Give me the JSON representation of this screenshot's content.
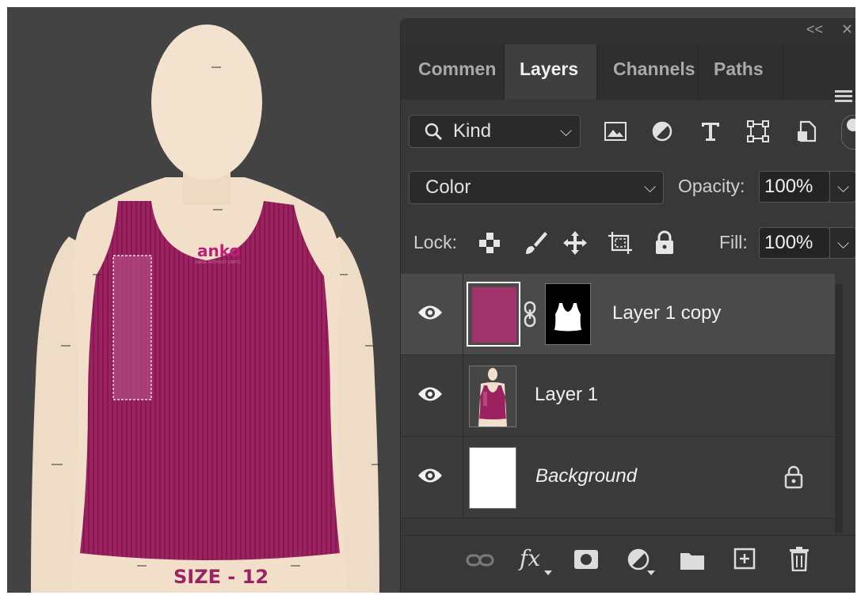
{
  "canvas": {
    "brand_logo": "anko",
    "brand_tagline": "MADE WITHOUT LIMITS",
    "size_label": "SIZE - 12",
    "garment_color": "#9c2160"
  },
  "panel": {
    "collapse_label": "<<",
    "close_label": "✕",
    "tabs": [
      {
        "label": "Commen"
      },
      {
        "label": "Layers"
      },
      {
        "label": "Channels"
      },
      {
        "label": "Paths"
      }
    ],
    "filter": {
      "label": "Kind"
    },
    "blend_mode": {
      "value": "Color"
    },
    "opacity": {
      "label": "Opacity:",
      "value": "100%"
    },
    "lock": {
      "label": "Lock:"
    },
    "fill": {
      "label": "Fill:",
      "value": "100%"
    },
    "layers": [
      {
        "name": "Layer 1 copy",
        "selected": true,
        "color": "#a0346a"
      },
      {
        "name": "Layer 1",
        "selected": false
      },
      {
        "name": "Background",
        "selected": false,
        "locked": true
      }
    ]
  }
}
